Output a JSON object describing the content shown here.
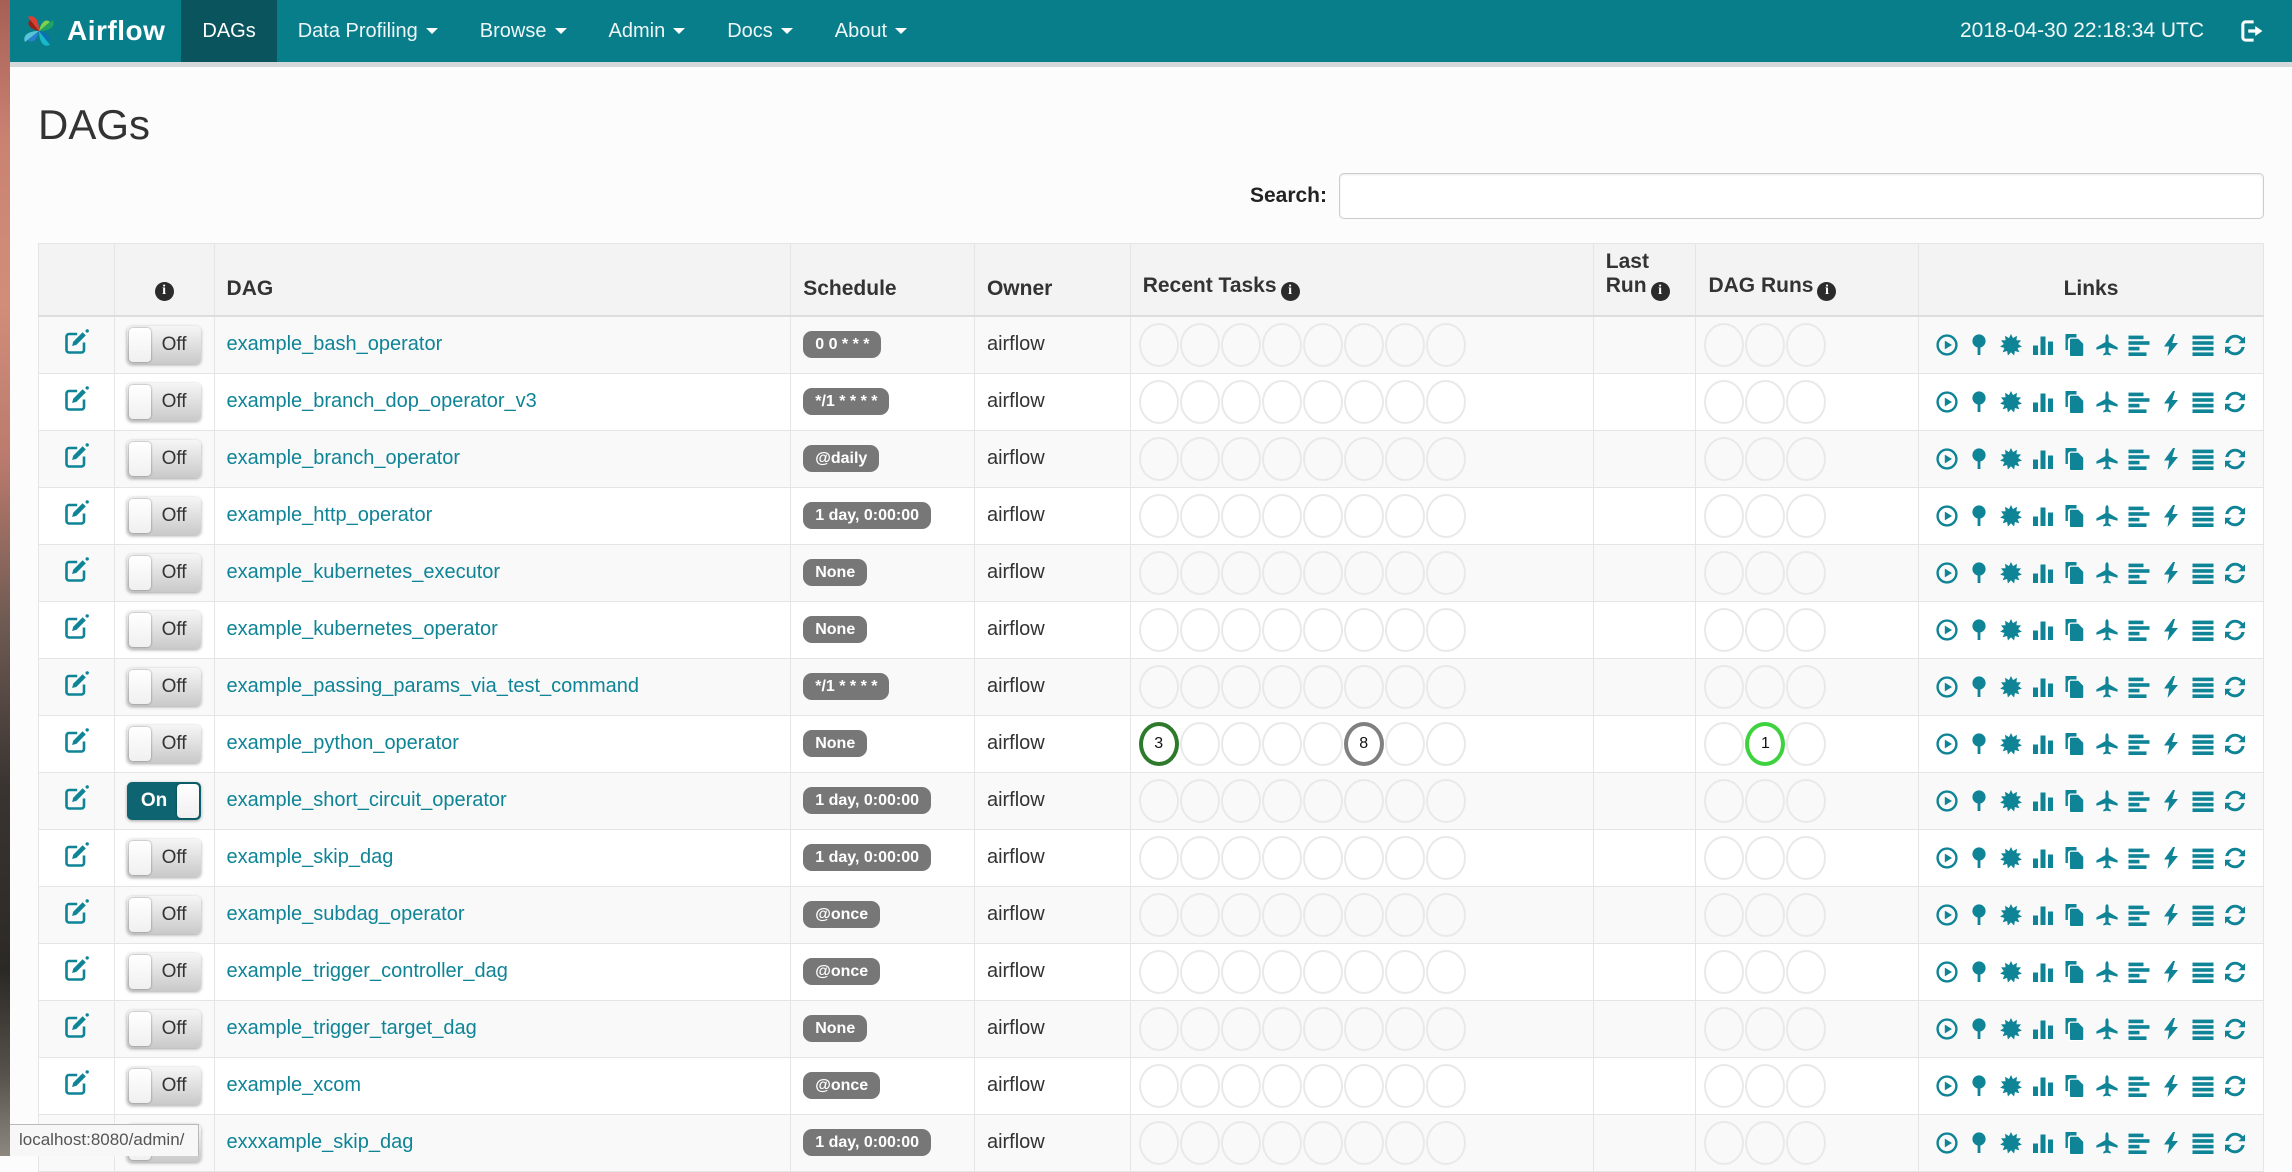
{
  "navbar": {
    "brand": "Airflow",
    "menu": [
      {
        "label": "DAGs",
        "active": true,
        "dropdown": false
      },
      {
        "label": "Data Profiling",
        "active": false,
        "dropdown": true
      },
      {
        "label": "Browse",
        "active": false,
        "dropdown": true
      },
      {
        "label": "Admin",
        "active": false,
        "dropdown": true
      },
      {
        "label": "Docs",
        "active": false,
        "dropdown": true
      },
      {
        "label": "About",
        "active": false,
        "dropdown": true
      }
    ],
    "clock": "2018-04-30 22:18:34 UTC"
  },
  "page_title": "DAGs",
  "search": {
    "label": "Search:",
    "value": "",
    "placeholder": ""
  },
  "icons": {
    "info_glyph": "i"
  },
  "table": {
    "headers": {
      "dag": "DAG",
      "schedule": "Schedule",
      "owner": "Owner",
      "recent_tasks": "Recent Tasks",
      "last_run": "Last Run",
      "dag_runs": "DAG Runs",
      "links": "Links"
    },
    "toggle_on_label": "On",
    "toggle_off_label": "Off",
    "recent_task_slots": 8,
    "dag_run_slots": 3,
    "link_actions": [
      "trigger-dag",
      "tree-view",
      "graph-view",
      "task-duration",
      "task-tries",
      "landing-times",
      "gantt",
      "code-view",
      "logs",
      "refresh"
    ],
    "rows": [
      {
        "dag_id": "example_bash_operator",
        "enabled": false,
        "schedule": "0 0 * * *",
        "owner": "airflow",
        "last_run": "",
        "recent_tasks": [],
        "dag_runs": []
      },
      {
        "dag_id": "example_branch_dop_operator_v3",
        "enabled": false,
        "schedule": "*/1 * * * *",
        "owner": "airflow",
        "last_run": "",
        "recent_tasks": [],
        "dag_runs": []
      },
      {
        "dag_id": "example_branch_operator",
        "enabled": false,
        "schedule": "@daily",
        "owner": "airflow",
        "last_run": "",
        "recent_tasks": [],
        "dag_runs": []
      },
      {
        "dag_id": "example_http_operator",
        "enabled": false,
        "schedule": "1 day, 0:00:00",
        "owner": "airflow",
        "last_run": "",
        "recent_tasks": [],
        "dag_runs": []
      },
      {
        "dag_id": "example_kubernetes_executor",
        "enabled": false,
        "schedule": "None",
        "owner": "airflow",
        "last_run": "",
        "recent_tasks": [],
        "dag_runs": []
      },
      {
        "dag_id": "example_kubernetes_operator",
        "enabled": false,
        "schedule": "None",
        "owner": "airflow",
        "last_run": "",
        "recent_tasks": [],
        "dag_runs": []
      },
      {
        "dag_id": "example_passing_params_via_test_command",
        "enabled": false,
        "schedule": "*/1 * * * *",
        "owner": "airflow",
        "last_run": "",
        "recent_tasks": [],
        "dag_runs": []
      },
      {
        "dag_id": "example_python_operator",
        "enabled": false,
        "schedule": "None",
        "owner": "airflow",
        "last_run": "",
        "recent_tasks": [
          {
            "slot": 0,
            "count": 3,
            "state": "success",
            "color": "#2d7a2d"
          },
          {
            "slot": 5,
            "count": 8,
            "state": "queued",
            "color": "#808080"
          }
        ],
        "dag_runs": [
          {
            "slot": 1,
            "count": 1,
            "state": "running",
            "color": "#3fd23f"
          }
        ]
      },
      {
        "dag_id": "example_short_circuit_operator",
        "enabled": true,
        "schedule": "1 day, 0:00:00",
        "owner": "airflow",
        "last_run": "",
        "recent_tasks": [],
        "dag_runs": []
      },
      {
        "dag_id": "example_skip_dag",
        "enabled": false,
        "schedule": "1 day, 0:00:00",
        "owner": "airflow",
        "last_run": "",
        "recent_tasks": [],
        "dag_runs": []
      },
      {
        "dag_id": "example_subdag_operator",
        "enabled": false,
        "schedule": "@once",
        "owner": "airflow",
        "last_run": "",
        "recent_tasks": [],
        "dag_runs": []
      },
      {
        "dag_id": "example_trigger_controller_dag",
        "enabled": false,
        "schedule": "@once",
        "owner": "airflow",
        "last_run": "",
        "recent_tasks": [],
        "dag_runs": []
      },
      {
        "dag_id": "example_trigger_target_dag",
        "enabled": false,
        "schedule": "None",
        "owner": "airflow",
        "last_run": "",
        "recent_tasks": [],
        "dag_runs": []
      },
      {
        "dag_id": "example_xcom",
        "enabled": false,
        "schedule": "@once",
        "owner": "airflow",
        "last_run": "",
        "recent_tasks": [],
        "dag_runs": []
      },
      {
        "dag_id": "exxxample_skip_dag",
        "enabled": false,
        "schedule": "1 day, 0:00:00",
        "owner": "airflow",
        "last_run": "",
        "recent_tasks": [],
        "dag_runs": []
      }
    ]
  },
  "statusbar": {
    "url": "localhost:8080/admin/"
  },
  "colors": {
    "navbar": "#087e8b",
    "navbar_active": "#0a545d",
    "accent": "#0e8496",
    "badge": "#777777",
    "success": "#2d7a2d",
    "running": "#3fd23f",
    "queued": "#808080"
  }
}
